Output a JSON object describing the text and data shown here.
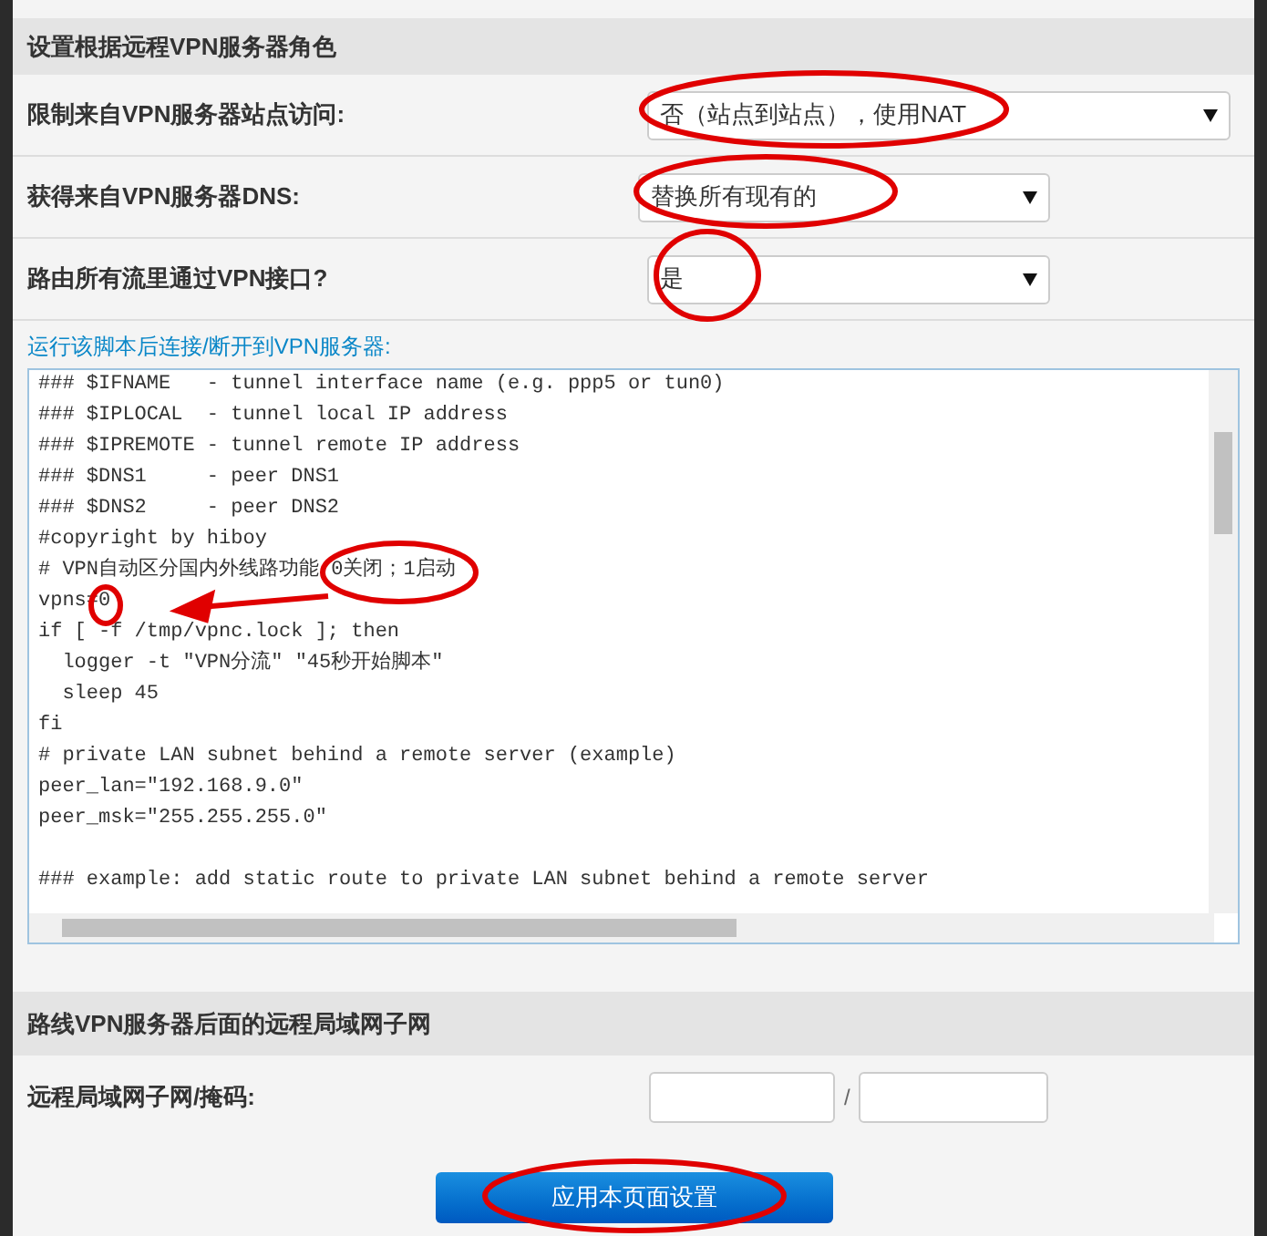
{
  "section_1": {
    "title": "设置根据远程VPN服务器角色",
    "fields": [
      {
        "label": "限制来自VPN服务器站点访问:",
        "value": "否（站点到站点），使用NAT"
      },
      {
        "label": "获得来自VPN服务器DNS:",
        "value": "替换所有现有的"
      },
      {
        "label": "路由所有流里通过VPN接口?",
        "value": "是"
      }
    ],
    "script_label": "运行该脚本后连接/断开到VPN服务器:",
    "script_blocks": [
      [
        "### $IFNAME   - tunnel interface name (e.g. ppp5 or tun0)",
        "### $IPLOCAL  - tunnel local IP address",
        "### $IPREMOTE - tunnel remote IP address",
        "### $DNS1     - peer DNS1",
        "### $DNS2     - peer DNS2",
        "#copyright by hiboy",
        "# VPN自动区分国内外线路功能 0关闭；1启动",
        "vpns=0",
        "if [ -f /tmp/vpnc.lock ]; then",
        "  logger -t \"VPN分流\" \"45秒开始脚本\"",
        "  sleep 45",
        "fi",
        "# private LAN subnet behind a remote server (example)",
        "peer_lan=\"192.168.9.0\"",
        "peer_msk=\"255.255.255.0\""
      ],
      [
        "### example: add static route to private LAN subnet behind a remote server"
      ]
    ]
  },
  "section_2": {
    "title": "路线VPN服务器后面的远程局域网子网",
    "subnet_label": "远程局域网子网/掩码:",
    "separator": "/"
  },
  "apply_button": "应用本页面设置"
}
